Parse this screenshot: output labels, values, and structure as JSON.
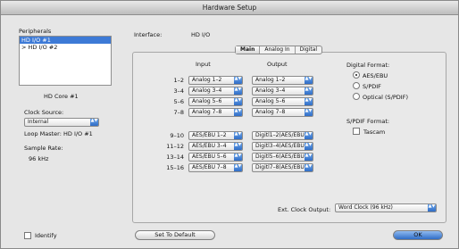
{
  "window": {
    "title": "Hardware Setup"
  },
  "peripherals": {
    "label": "Peripherals",
    "items": [
      "HD I/O #1",
      "> HD I/O #2"
    ]
  },
  "left": {
    "core_label": "HD Core #1",
    "clock_source_label": "Clock Source:",
    "clock_source_value": "Internal",
    "loop_master": "Loop Master: HD I/O #1",
    "sample_rate_label": "Sample Rate:",
    "sample_rate_value": "96 kHz",
    "identify_label": "Identify"
  },
  "interface": {
    "label": "Interface:",
    "value": "HD I/O"
  },
  "tabs": [
    "Main",
    "Analog In",
    "Digital"
  ],
  "routing": {
    "input_header": "Input",
    "output_header": "Output",
    "rows": [
      {
        "ch": "1–2",
        "in": "Analog 1–2",
        "out": "Analog 1–2"
      },
      {
        "ch": "3–4",
        "in": "Analog 3–4",
        "out": "Analog 3–4"
      },
      {
        "ch": "5–6",
        "in": "Analog 5–6",
        "out": "Analog 5–6"
      },
      {
        "ch": "7–8",
        "in": "Analog 7–8",
        "out": "Analog 7–8"
      },
      {
        "ch": "9–10",
        "in": "AES/EBU 1–2",
        "out": "Digitl1–2(AES/EBU)"
      },
      {
        "ch": "11–12",
        "in": "AES/EBU 3–4",
        "out": "Digitl3–4(AES/EBU)"
      },
      {
        "ch": "13–14",
        "in": "AES/EBU 5–6",
        "out": "Digitl5–6(AES/EBU)"
      },
      {
        "ch": "15–16",
        "in": "AES/EBU 7–8",
        "out": "Digitl7–8(AES/EBU)"
      }
    ]
  },
  "digital_format": {
    "label": "Digital Format:",
    "options": [
      "AES/EBU",
      "S/PDIF",
      "Optical (S/PDIF)"
    ],
    "selected": "AES/EBU"
  },
  "spdif_format": {
    "label": "S/PDIF Format:",
    "tascam_label": "Tascam"
  },
  "ext_clock": {
    "label": "Ext. Clock Output:",
    "value": "Word Clock (96 kHz)"
  },
  "buttons": {
    "set_default": "Set To Default",
    "ok": "OK"
  },
  "popup_arrows": "▲▼"
}
